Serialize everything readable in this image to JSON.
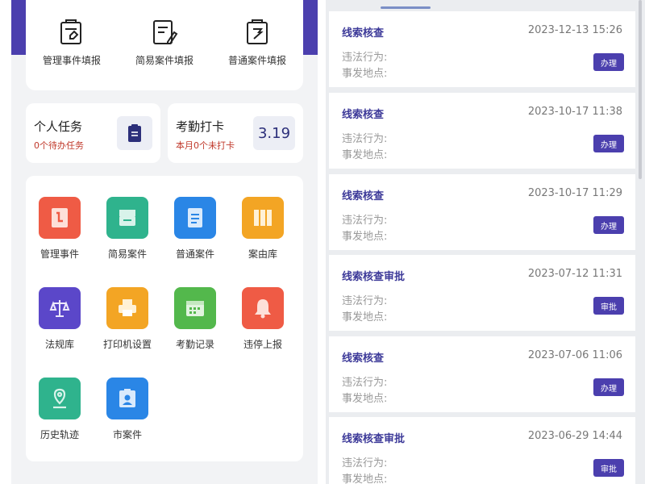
{
  "forms": [
    {
      "label": "管理事件填报",
      "icon": "manage-form-icon"
    },
    {
      "label": "简易案件填报",
      "icon": "simple-form-icon"
    },
    {
      "label": "普通案件填报",
      "icon": "normal-form-icon"
    }
  ],
  "tasks": {
    "title": "个人任务",
    "subtitle": "0个待办任务",
    "icon": "clipboard-icon"
  },
  "attendance": {
    "title": "考勤打卡",
    "subtitle": "本月0个未打卡",
    "date": "3.19"
  },
  "apps": [
    {
      "label": "管理事件",
      "color": "#ef5b45",
      "icon": "manage-event-icon"
    },
    {
      "label": "简易案件",
      "color": "#2fb38d",
      "icon": "simple-case-icon"
    },
    {
      "label": "普通案件",
      "color": "#2a86e6",
      "icon": "normal-case-icon"
    },
    {
      "label": "案由库",
      "color": "#f3a524",
      "icon": "library-icon"
    },
    {
      "label": "法规库",
      "color": "#5b47c9",
      "icon": "scales-icon"
    },
    {
      "label": "打印机设置",
      "color": "#f3a524",
      "icon": "printer-icon"
    },
    {
      "label": "考勤记录",
      "color": "#53b84c",
      "icon": "calendar-icon"
    },
    {
      "label": "违停上报",
      "color": "#ef5b45",
      "icon": "bell-icon"
    },
    {
      "label": "历史轨迹",
      "color": "#2fb38d",
      "icon": "location-icon"
    },
    {
      "label": "市案件",
      "color": "#2a86e6",
      "icon": "id-badge-icon"
    }
  ],
  "items": [
    {
      "title": "线索核查",
      "time": "2023-12-13 15:26",
      "line1": "违法行为:",
      "line2": "事发地点:",
      "action": "办理"
    },
    {
      "title": "线索核查",
      "time": "2023-10-17 11:38",
      "line1": "违法行为:",
      "line2": "事发地点:",
      "action": "办理"
    },
    {
      "title": "线索核查",
      "time": "2023-10-17 11:29",
      "line1": "违法行为:",
      "line2": "事发地点:",
      "action": "办理"
    },
    {
      "title": "线索核查审批",
      "time": "2023-07-12 11:31",
      "line1": "违法行为:",
      "line2": "事发地点:",
      "action": "审批"
    },
    {
      "title": "线索核查",
      "time": "2023-07-06 11:06",
      "line1": "违法行为:",
      "line2": "事发地点:",
      "action": "办理"
    },
    {
      "title": "线索核查审批",
      "time": "2023-06-29 14:44",
      "line1": "违法行为:",
      "line2": "事发地点:",
      "action": "审批"
    }
  ],
  "colors": {
    "brand": "#4b3fae",
    "alert": "#c0392b",
    "title": "#3d3a99"
  }
}
